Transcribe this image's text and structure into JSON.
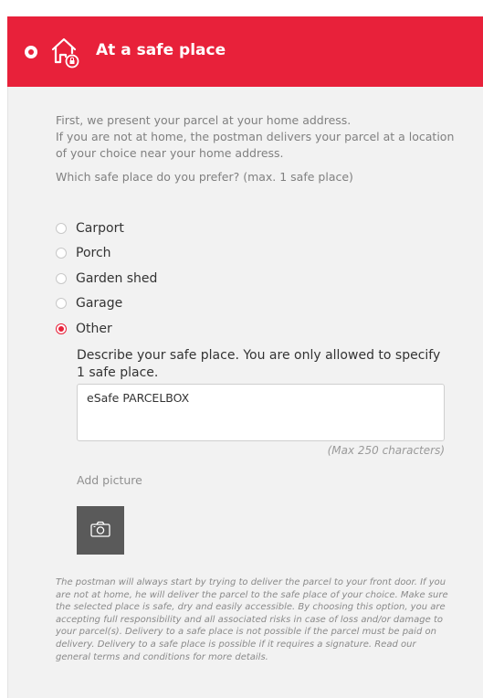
{
  "header": {
    "title": "At a safe place",
    "icon": "house-lock-icon",
    "accent": "#e8213a"
  },
  "intro": {
    "line1": "First, we present your parcel at your home address.",
    "line2": "If you are not at home, the postman delivers your parcel at a location of your choice near your home address."
  },
  "question": "Which safe place do you prefer? (max. 1 safe place)",
  "options": [
    {
      "label": "Carport",
      "selected": false
    },
    {
      "label": "Porch",
      "selected": false
    },
    {
      "label": "Garden shed",
      "selected": false
    },
    {
      "label": "Garage",
      "selected": false
    },
    {
      "label": "Other",
      "selected": true
    }
  ],
  "describe": {
    "label": "Describe your safe place. You are only allowed to specify 1 safe place.",
    "value": "eSafe PARCELBOX",
    "max": "(Max 250 characters)"
  },
  "picture": {
    "label": "Add picture",
    "icon": "camera-icon"
  },
  "disclaimer": "The postman will always start by trying to deliver the parcel to your front door. If you are not at home, he will deliver the parcel to the safe place of your choice. Make sure the selected place is safe, dry and easily accessible. By choosing this option, you are accepting full responsibility and all associated risks in case of loss and/or damage to your parcel(s). Delivery to a safe place is not possible if the parcel must be paid on delivery. Delivery to a safe place is possible if it requires a signature. Read our general terms and conditions for more details."
}
